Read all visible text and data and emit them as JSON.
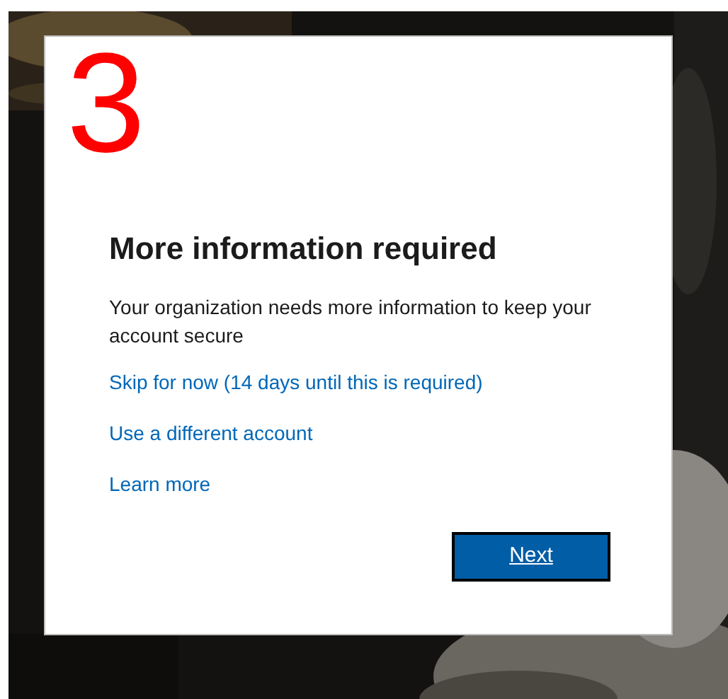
{
  "step_number": "3",
  "dialog": {
    "title": "More information required",
    "message": "Your organization needs more information to keep your account secure",
    "links": [
      "Skip for now (14 days until this is required)",
      "Use a different account",
      "Learn more"
    ],
    "button": "Next"
  }
}
